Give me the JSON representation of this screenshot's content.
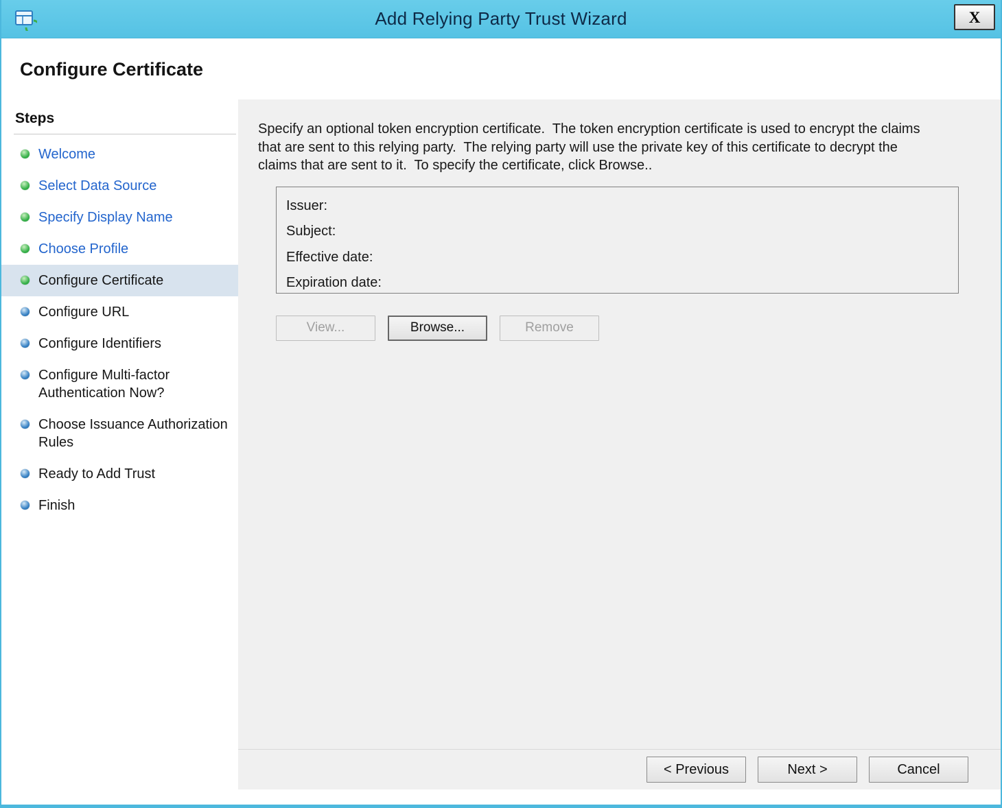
{
  "window": {
    "title": "Add Relying Party Trust Wizard",
    "close_label": "X"
  },
  "header": {
    "title": "Configure Certificate"
  },
  "sidebar": {
    "heading": "Steps",
    "items": [
      {
        "label": "Welcome",
        "state": "completed"
      },
      {
        "label": "Select Data Source",
        "state": "completed"
      },
      {
        "label": "Specify Display Name",
        "state": "completed"
      },
      {
        "label": "Choose Profile",
        "state": "completed"
      },
      {
        "label": "Configure Certificate",
        "state": "current"
      },
      {
        "label": "Configure URL",
        "state": "upcoming"
      },
      {
        "label": "Configure Identifiers",
        "state": "upcoming"
      },
      {
        "label": "Configure Multi-factor Authentication Now?",
        "state": "upcoming"
      },
      {
        "label": "Choose Issuance Authorization Rules",
        "state": "upcoming"
      },
      {
        "label": "Ready to Add Trust",
        "state": "upcoming"
      },
      {
        "label": "Finish",
        "state": "upcoming"
      }
    ]
  },
  "content": {
    "description": "Specify an optional token encryption certificate.  The token encryption certificate is used to encrypt the claims that are sent to this relying party.  The relying party will use the private key of this certificate to decrypt the claims that are sent to it.  To specify the certificate, click Browse..",
    "certificate_fields": [
      "Issuer:",
      "Subject:",
      "Effective date:",
      "Expiration date:"
    ],
    "buttons": {
      "view": "View...",
      "browse": "Browse...",
      "remove": "Remove"
    }
  },
  "footer": {
    "previous": "< Previous",
    "next": "Next >",
    "cancel": "Cancel"
  },
  "colors": {
    "titlebar": "#5bc6e8",
    "window_border": "#4cb8dd",
    "link": "#2365cd",
    "completed_bullet": "#37b14a",
    "upcoming_bullet": "#3781c4",
    "current_step_highlight": "#d8e3ee",
    "content_background": "#f0f0f0"
  }
}
